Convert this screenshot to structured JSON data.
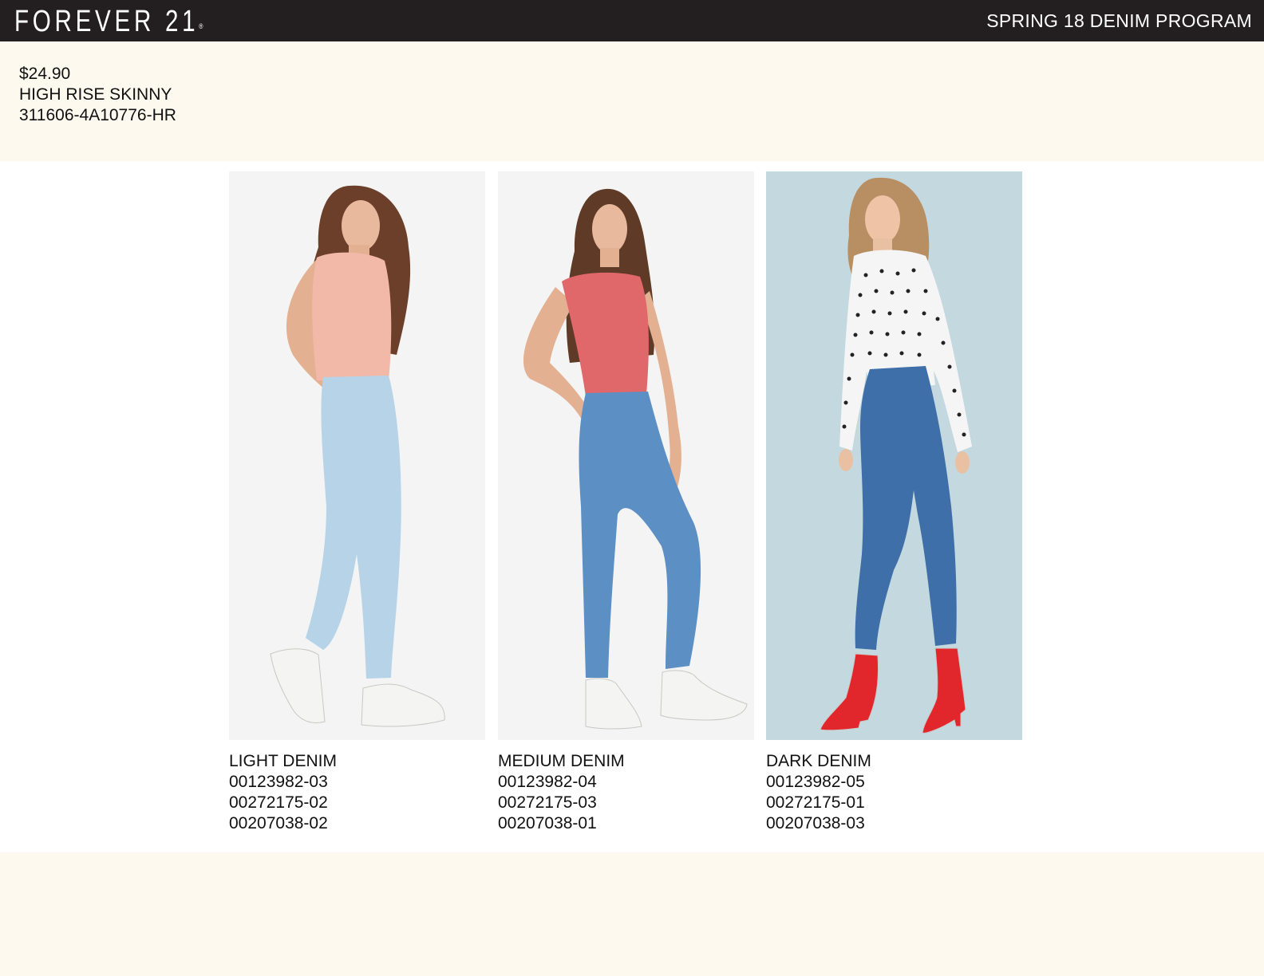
{
  "header": {
    "brand": "FOREVER 21",
    "brand_mark": "®",
    "program": "SPRING 18 DENIM PROGRAM"
  },
  "product": {
    "price": "$24.90",
    "name": "HIGH RISE SKINNY",
    "style_number": "311606-4A10776-HR"
  },
  "variants": [
    {
      "wash": "LIGHT DENIM",
      "codes": [
        "00123982-03",
        "00272175-02",
        "00207038-02"
      ],
      "top_color": "#f2b8a8",
      "jeans_color": "#b7d3e8",
      "shoe_color": "#f4f4f2",
      "bg_color": "#f3f4f3"
    },
    {
      "wash": "MEDIUM DENIM",
      "codes": [
        "00123982-04",
        "00272175-03",
        "00207038-01"
      ],
      "top_color": "#e0686a",
      "jeans_color": "#5c8fc4",
      "shoe_color": "#f4f4f2",
      "bg_color": "#f3f4f3"
    },
    {
      "wash": "DARK DENIM",
      "codes": [
        "00123982-05",
        "00272175-01",
        "00207038-03"
      ],
      "top_color": "#f5f5f5",
      "jeans_color": "#3f6fa8",
      "shoe_color": "#e2272c",
      "bg_color": "#c4d8df"
    }
  ]
}
